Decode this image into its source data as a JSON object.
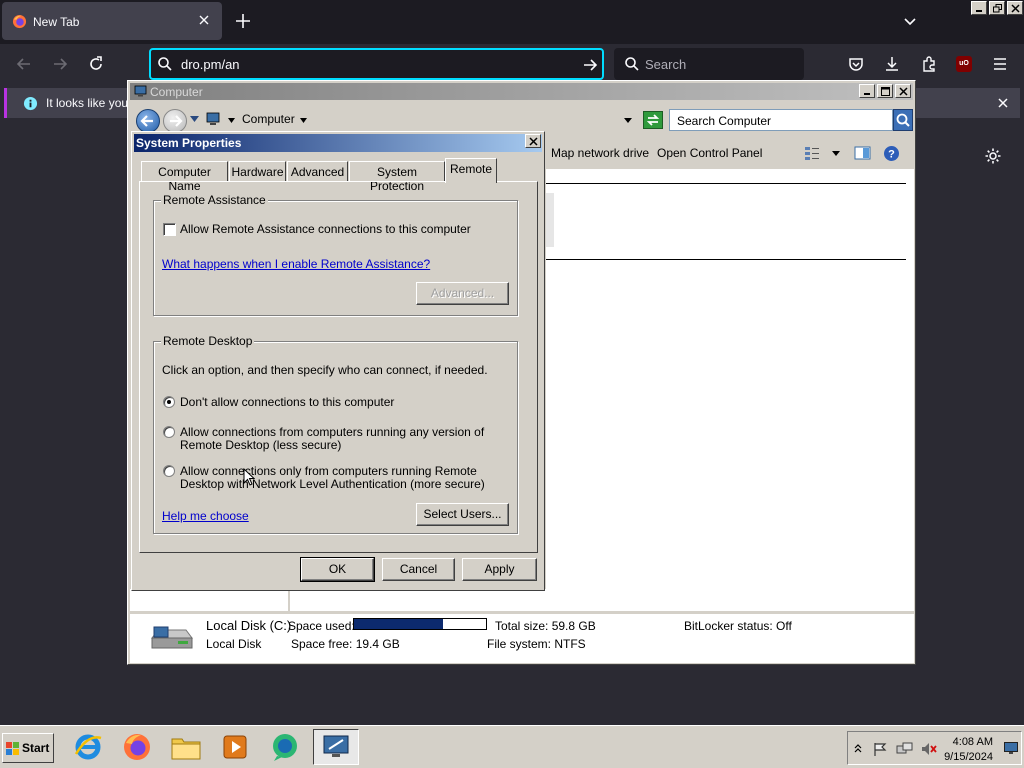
{
  "browser": {
    "tab_title": "New Tab",
    "url": "dro.pm/an",
    "search_placeholder": "Search",
    "infobar_text": "It looks like you h",
    "colors": {
      "url_focus": "#00ddff",
      "infobar_accent": "#b833e1"
    }
  },
  "explorer": {
    "title": "Computer",
    "breadcrumb": "Computer",
    "search_placeholder": "Search Computer",
    "commands": [
      "Map network drive",
      "Open Control Panel"
    ],
    "details": {
      "drive_name": "Local Disk (C:)",
      "drive_type": "Local Disk",
      "space_used_label": "Space used:",
      "space_used_fraction": 0.676,
      "space_free": "Space free: 19.4 GB",
      "total_size": "Total size: 59.8 GB",
      "file_system": "File system: NTFS",
      "bitlocker": "BitLocker status: Off"
    }
  },
  "dialog": {
    "title": "System Properties",
    "tabs": [
      "Computer Name",
      "Hardware",
      "Advanced",
      "System Protection",
      "Remote"
    ],
    "active_tab": "Remote",
    "remote_assistance": {
      "legend": "Remote Assistance",
      "checkbox_label": "Allow Remote Assistance connections to this computer",
      "checked": false,
      "help_link": "What happens when I enable Remote Assistance?",
      "advanced_button": "Advanced..."
    },
    "remote_desktop": {
      "legend": "Remote Desktop",
      "intro": "Click an option, and then specify who can connect, if needed.",
      "options": [
        {
          "line1": "Don't allow connections to this computer",
          "line2": "",
          "selected": true
        },
        {
          "line1": "Allow connections from computers running any version of",
          "line2": "Remote Desktop (less secure)",
          "selected": false
        },
        {
          "line1": "Allow connections only from computers running Remote",
          "line2": "Desktop with Network Level Authentication (more secure)",
          "selected": false
        }
      ],
      "help_link": "Help me choose",
      "select_users_button": "Select Users..."
    },
    "buttons": {
      "ok": "OK",
      "cancel": "Cancel",
      "apply": "Apply"
    }
  },
  "taskbar": {
    "start_label": "Start",
    "apps": [
      "internet-explorer-icon",
      "firefox-icon",
      "file-explorer-icon",
      "media-player-icon",
      "chat-icon",
      "remote-desktop-icon"
    ],
    "clock_time": "4:08 AM",
    "clock_date": "9/15/2024"
  }
}
